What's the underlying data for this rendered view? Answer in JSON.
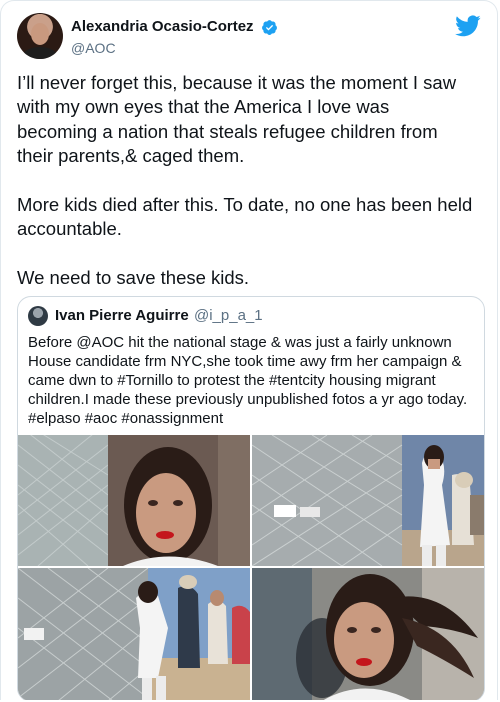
{
  "tweet": {
    "author": {
      "display_name": "Alexandria Ocasio-Cortez",
      "handle": "@AOC",
      "verified": true
    },
    "text": "I’ll never forget this, because it was the moment I saw\nwith my own eyes that the America I love was\nbecoming a nation that steals refugee children from\ntheir parents,& caged them.\n\nMore kids died after this. To date, no one has been held\naccountable.\n\nWe need to save these kids.",
    "brand_icon": "twitter-bird-icon",
    "accent_color": "#1da1f2"
  },
  "quoted_tweet": {
    "author": {
      "display_name": "Ivan Pierre Aguirre",
      "handle": "@i_p_a_1"
    },
    "text": "Before @AOC hit the national stage & was just a fairly unknown\nHouse candidate frm NYC,she took time awy frm her campaign &\ncame dwn to #Tornillo to protest the #tentcity housing migrant\nchildren.I made these previously unpublished fotos a yr ago today.\n#elpaso #aoc #onassignment",
    "photos": [
      {
        "name": "photo-closeup-fence"
      },
      {
        "name": "photo-fence-line"
      },
      {
        "name": "photo-walking-fence"
      },
      {
        "name": "photo-closeup-wind"
      }
    ]
  }
}
